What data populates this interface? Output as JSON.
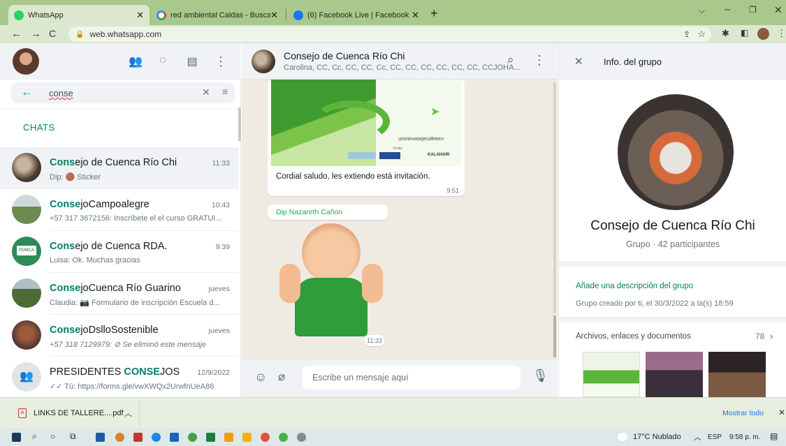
{
  "browser": {
    "tabs": [
      {
        "title": "WhatsApp",
        "icon": "whatsapp-icon"
      },
      {
        "title": "red ambiental Caldas - Buscar co",
        "icon": "google-icon"
      },
      {
        "title": "(6) Facebook Live | Facebook",
        "icon": "facebook-icon"
      }
    ],
    "new_tab": "+",
    "url": "web.whatsapp.com"
  },
  "search": {
    "value": "conse"
  },
  "chats_label": "CHATS",
  "chats": [
    {
      "hl": "Cons",
      "rest": "ejo de Cuenca Río Chi",
      "time": "11:33",
      "preview": "Dip: 🟤 Sticker"
    },
    {
      "hl": "Conse",
      "rest": "joCampoalegre",
      "time": "10:43",
      "preview": "+57 317 3672156: Inscríbete el el curso GRATUI..."
    },
    {
      "hl": "Cons",
      "rest": "ejo de Cuenca RDA.",
      "time": "9:39",
      "preview": "Luisa: Ok. Muchas gracias"
    },
    {
      "hl": "Conse",
      "rest": "joCuenca Río Guarino",
      "time": "jueves",
      "preview": "Claudia: 📷 Formulario de inscripción Escuela d..."
    },
    {
      "hl": "Conse",
      "rest": "joDslloSostenible",
      "time": "jueves",
      "preview": "+57 318 7129979: ⊘ Se eliminó este mensaje"
    },
    {
      "pre": "PRESIDENTES ",
      "hl": "CONSE",
      "rest": "JOS",
      "time": "12/9/2022",
      "preview": "✓✓ Tú: https://forms.gle/vwXWQx2UrwfnUeA86"
    }
  ],
  "conversation": {
    "title": "Consejo de Cuenca Río Chi",
    "members": "Carolina, CC, Cc, CC, CC, Cc, CC, CC, CC, CC, CC, CC, CCJOHA...",
    "flyer_brand": "uniminutoejecafetero",
    "flyer_label": "Invita:",
    "flyer_partner": "KALAHARI",
    "message_text": "Cordial saludo, les extiendo está invitación.",
    "message_time": "9:51",
    "sender": "Dip Nazareth Cañon",
    "sticker_time": "11:33",
    "input_placeholder": "Escribe un mensaje aquí"
  },
  "group_info": {
    "header": "Info. del grupo",
    "name": "Consejo de Cuenca Río Chi",
    "subtitle": "Grupo · 42 participantes",
    "add_description": "Añade una descripción del grupo",
    "created": "Grupo creado por ti, el 30/3/2022 a la(s) 18:59",
    "media_label": "Archivos, enlaces y documentos",
    "media_count": "78"
  },
  "downloads": {
    "file": "LINKS DE TALLERE....pdf",
    "show_all": "Mostrar todo"
  },
  "taskbar": {
    "weather": "17°C  Nublado",
    "lang": "ESP",
    "time": "9:58 p. m."
  },
  "colors": {
    "accent": "#008069",
    "chrome": "#a9c88c"
  }
}
